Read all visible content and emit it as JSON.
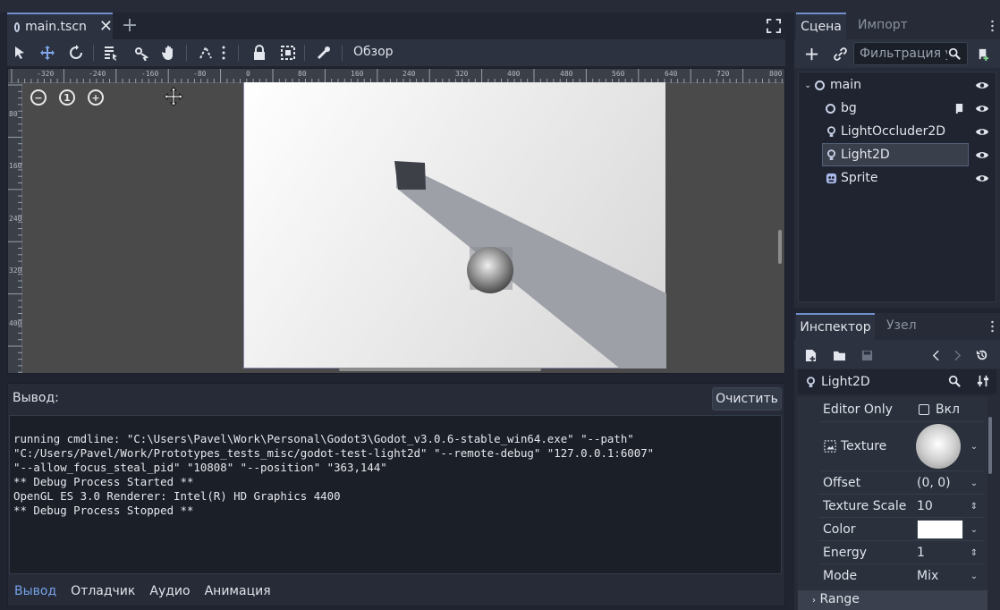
{
  "editor": {
    "tab_title": "main.tscn",
    "toolbar_overview": "Обзор"
  },
  "rulers": {
    "top": [
      "-320",
      "-240",
      "-160",
      "-80",
      "0",
      "80",
      "160",
      "240",
      "320",
      "400",
      "480",
      "560",
      "640",
      "720",
      "800"
    ],
    "left": [
      "80",
      "160",
      "240",
      "320",
      "400"
    ]
  },
  "zoom": {
    "reset_label": "1"
  },
  "output": {
    "title": "Вывод:",
    "clear_label": "Очистить",
    "lines": [
      "running cmdline: \"C:\\Users\\Pavel\\Work\\Personal\\Godot3\\Godot_v3.0.6-stable_win64.exe\" \"--path\"",
      "\"C:/Users/Pavel/Work/Prototypes_tests_misc/godot-test-light2d\" \"--remote-debug\" \"127.0.0.1:6007\"",
      "\"--allow_focus_steal_pid\" \"10808\" \"--position\" \"363,144\"",
      "** Debug Process Started **",
      "OpenGL ES 3.0 Renderer: Intel(R) HD Graphics 4400",
      "** Debug Process Stopped **"
    ],
    "tabs": [
      "Вывод",
      "Отладчик",
      "Аудио",
      "Анимация"
    ]
  },
  "scene_dock": {
    "tab_scene": "Сцена",
    "tab_import": "Импорт",
    "filter_placeholder": "Фильтрация у",
    "nodes": [
      {
        "label": "main"
      },
      {
        "label": "bg"
      },
      {
        "label": "LightOccluder2D"
      },
      {
        "label": "Light2D"
      },
      {
        "label": "Sprite"
      }
    ]
  },
  "inspector": {
    "tab_inspector": "Инспектор",
    "tab_node": "Узел",
    "node_name": "Light2D",
    "props": {
      "editor_only": {
        "name": "Editor Only",
        "value": "Вкл"
      },
      "texture": {
        "name": "Texture"
      },
      "offset": {
        "name": "Offset",
        "value": "(0, 0)"
      },
      "texture_scale": {
        "name": "Texture Scale",
        "value": "10"
      },
      "color": {
        "name": "Color",
        "value_hex": "#ffffff"
      },
      "energy": {
        "name": "Energy",
        "value": "1"
      },
      "mode": {
        "name": "Mode",
        "value": "Mix"
      }
    },
    "range_label": "Range"
  },
  "colors": {
    "accent": "#6f8ecb",
    "active_tab_text": "#77a2e8"
  }
}
